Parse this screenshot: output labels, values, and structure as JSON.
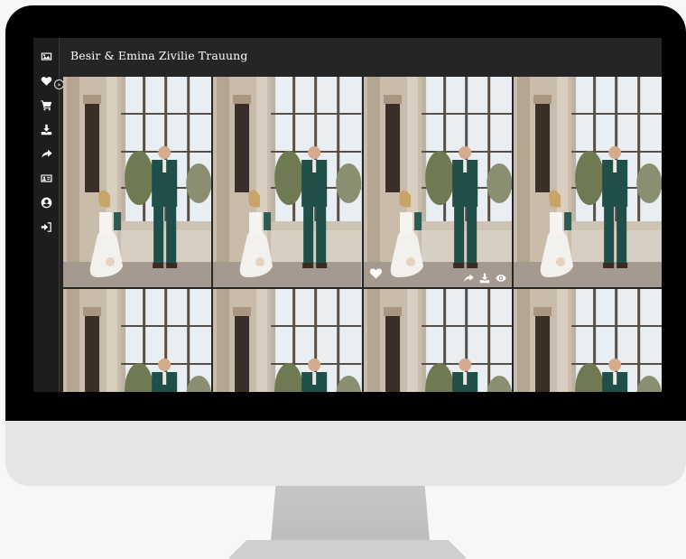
{
  "gallery": {
    "title": "Besir & Emina Zivilie Trauung"
  },
  "sidebar": {
    "items": [
      {
        "icon": "image-icon"
      },
      {
        "icon": "heart-icon"
      },
      {
        "icon": "cart-icon"
      },
      {
        "icon": "download-icon"
      },
      {
        "icon": "share-icon"
      },
      {
        "icon": "id-card-icon"
      },
      {
        "icon": "user-circle-icon"
      },
      {
        "icon": "sign-in-icon"
      }
    ],
    "toggle_icon": "double-chevron-right-icon"
  },
  "photos": {
    "count": 8,
    "hovered_index": 2
  },
  "hover_actions": [
    "heart-icon",
    "share-icon",
    "download-icon",
    "eye-icon"
  ]
}
